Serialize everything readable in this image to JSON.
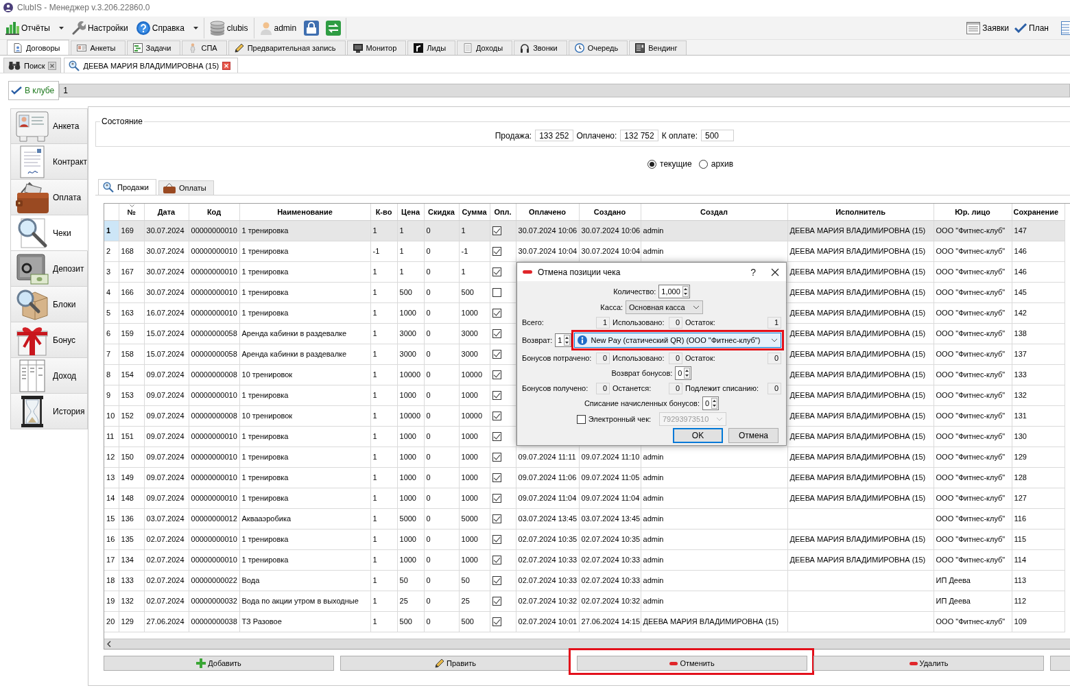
{
  "window": {
    "title": "ClubIS - Менеджер v.3.206.22860.0"
  },
  "toolbar": {
    "groups": [
      [
        {
          "label": "Отчёты",
          "dropdown": true
        },
        {
          "label": "Настройки",
          "dropdown": false
        },
        {
          "label": "Справка",
          "dropdown": true
        }
      ],
      [
        {
          "label": "clubis",
          "dropdown": false
        }
      ],
      [
        {
          "label": "admin",
          "dropdown": false
        }
      ]
    ],
    "right": [
      {
        "label": "Заявки"
      },
      {
        "label": "План"
      }
    ]
  },
  "main_tabs": [
    {
      "label": "Договоры",
      "selected": true
    },
    {
      "label": "Анкеты",
      "selected": false
    },
    {
      "label": "Задачи",
      "selected": false
    },
    {
      "label": "СПА",
      "selected": false
    },
    {
      "label": "Предварительная запись",
      "selected": false
    },
    {
      "label": "Монитор",
      "selected": false
    },
    {
      "label": "Лиды",
      "selected": false
    },
    {
      "label": "Доходы",
      "selected": false
    },
    {
      "label": "Звонки",
      "selected": false
    },
    {
      "label": "Очередь",
      "selected": false
    },
    {
      "label": "Вендинг",
      "selected": false
    }
  ],
  "document_tabs": [
    {
      "label": "Поиск",
      "selected": false
    },
    {
      "label": "ДЕЕВА МАРИЯ ВЛАДИМИРОВНА (15)",
      "selected": true
    }
  ],
  "client_status": {
    "label": "В клубе",
    "value": "1"
  },
  "sidebar": {
    "items": [
      {
        "label": "Анкета",
        "selected": false
      },
      {
        "label": "Контракт",
        "selected": false
      },
      {
        "label": "Оплата",
        "selected": false
      },
      {
        "label": "Чеки",
        "selected": true
      },
      {
        "label": "Депозит",
        "selected": false
      },
      {
        "label": "Блоки",
        "selected": false
      },
      {
        "label": "Бонус",
        "selected": false
      },
      {
        "label": "Доход",
        "selected": false
      },
      {
        "label": "История",
        "selected": false
      }
    ]
  },
  "state": {
    "title": "Состояние",
    "fields": [
      {
        "label": "Продажа:",
        "value": "133 252"
      },
      {
        "label": "Оплачено:",
        "value": "132 752"
      },
      {
        "label": "К оплате:",
        "value": "500"
      }
    ]
  },
  "filter": [
    {
      "label": "текущие",
      "selected": true
    },
    {
      "label": "архив",
      "selected": false
    }
  ],
  "sub_tabs": [
    {
      "label": "Продажи",
      "selected": true
    },
    {
      "label": "Оплаты",
      "selected": false
    }
  ],
  "table": {
    "columns": [
      "№",
      "Дата",
      "Код",
      "Наименование",
      "К-во",
      "Цена",
      "Скидка",
      "Сумма",
      "Опл.",
      "Оплачено",
      "Создано",
      "Создал",
      "Исполнитель",
      "Юр. лицо",
      "Сохранение"
    ],
    "rows": [
      {
        "n": "1",
        "selected": true,
        "no": "169",
        "date": "30.07.2024",
        "code": "00000000010",
        "name": "1 тренировка",
        "qty": "1",
        "price": "1",
        "discount": "0",
        "sum": "1",
        "paid": true,
        "paid_at": "30.07.2024 10:06",
        "created_at": "30.07.2024 10:06",
        "created_by": "admin",
        "executor": "ДЕЕВА МАРИЯ ВЛАДИМИРОВНА (15)",
        "legal_entity": "ООО \"Фитнес-клуб\"",
        "saved": "147"
      },
      {
        "n": "2",
        "selected": false,
        "no": "168",
        "date": "30.07.2024",
        "code": "00000000010",
        "name": "1 тренировка",
        "qty": "-1",
        "price": "1",
        "discount": "0",
        "sum": "-1",
        "paid": true,
        "paid_at": "30.07.2024 10:04",
        "created_at": "30.07.2024 10:04",
        "created_by": "admin",
        "executor": "ДЕЕВА МАРИЯ ВЛАДИМИРОВНА (15)",
        "legal_entity": "ООО \"Фитнес-клуб\"",
        "saved": "146"
      },
      {
        "n": "3",
        "selected": false,
        "no": "167",
        "date": "30.07.2024",
        "code": "00000000010",
        "name": "1 тренировка",
        "qty": "1",
        "price": "1",
        "discount": "0",
        "sum": "1",
        "paid": true,
        "executor": "ДЕЕВА МАРИЯ ВЛАДИМИРОВНА (15)",
        "legal_entity": "ООО \"Фитнес-клуб\"",
        "saved": "146"
      },
      {
        "n": "4",
        "selected": false,
        "no": "166",
        "date": "30.07.2024",
        "code": "00000000010",
        "name": "1 тренировка",
        "qty": "1",
        "price": "500",
        "discount": "0",
        "sum": "500",
        "paid": false,
        "executor": "ДЕЕВА МАРИЯ ВЛАДИМИРОВНА (15)",
        "legal_entity": "ООО \"Фитнес-клуб\"",
        "saved": "145"
      },
      {
        "n": "5",
        "selected": false,
        "no": "163",
        "date": "16.07.2024",
        "code": "00000000010",
        "name": "1 тренировка",
        "qty": "1",
        "price": "1000",
        "discount": "0",
        "sum": "1000",
        "paid": true,
        "executor": "ДЕЕВА МАРИЯ ВЛАДИМИРОВНА (15)",
        "legal_entity": "ООО \"Фитнес-клуб\"",
        "saved": "142"
      },
      {
        "n": "6",
        "selected": false,
        "no": "159",
        "date": "15.07.2024",
        "code": "00000000058",
        "name": "Аренда кабинки в раздевалке",
        "qty": "1",
        "price": "3000",
        "discount": "0",
        "sum": "3000",
        "paid": true,
        "executor": "ДЕЕВА МАРИЯ ВЛАДИМИРОВНА (15)",
        "legal_entity": "ООО \"Фитнес-клуб\"",
        "saved": "138"
      },
      {
        "n": "7",
        "selected": false,
        "no": "158",
        "date": "15.07.2024",
        "code": "00000000058",
        "name": "Аренда кабинки в раздевалке",
        "qty": "1",
        "price": "3000",
        "discount": "0",
        "sum": "3000",
        "paid": true,
        "executor": "ДЕЕВА МАРИЯ ВЛАДИМИРОВНА (15)",
        "legal_entity": "ООО \"Фитнес-клуб\"",
        "saved": "137"
      },
      {
        "n": "8",
        "selected": false,
        "no": "154",
        "date": "09.07.2024",
        "code": "00000000008",
        "name": "10 тренировок",
        "qty": "1",
        "price": "10000",
        "discount": "0",
        "sum": "10000",
        "paid": true,
        "executor": "ДЕЕВА МАРИЯ ВЛАДИМИРОВНА (15)",
        "legal_entity": "ООО \"Фитнес-клуб\"",
        "saved": "133"
      },
      {
        "n": "9",
        "selected": false,
        "no": "153",
        "date": "09.07.2024",
        "code": "00000000010",
        "name": "1 тренировка",
        "qty": "1",
        "price": "1000",
        "discount": "0",
        "sum": "1000",
        "paid": true,
        "executor": "ДЕЕВА МАРИЯ ВЛАДИМИРОВНА (15)",
        "legal_entity": "ООО \"Фитнес-клуб\"",
        "saved": "132"
      },
      {
        "n": "10",
        "selected": false,
        "no": "152",
        "date": "09.07.2024",
        "code": "00000000008",
        "name": "10 тренировок",
        "qty": "1",
        "price": "10000",
        "discount": "0",
        "sum": "10000",
        "paid": true,
        "executor": "ДЕЕВА МАРИЯ ВЛАДИМИРОВНА (15)",
        "legal_entity": "ООО \"Фитнес-клуб\"",
        "saved": "131"
      },
      {
        "n": "11",
        "selected": false,
        "no": "151",
        "date": "09.07.2024",
        "code": "00000000010",
        "name": "1 тренировка",
        "qty": "1",
        "price": "1000",
        "discount": "0",
        "sum": "1000",
        "paid": true,
        "executor": "ДЕЕВА МАРИЯ ВЛАДИМИРОВНА (15)",
        "legal_entity": "ООО \"Фитнес-клуб\"",
        "saved": "130"
      },
      {
        "n": "12",
        "selected": false,
        "no": "150",
        "date": "09.07.2024",
        "code": "00000000010",
        "name": "1 тренировка",
        "qty": "1",
        "price": "1000",
        "discount": "0",
        "sum": "1000",
        "paid": true,
        "paid_at": "09.07.2024 11:11",
        "created_at": "09.07.2024 11:10",
        "created_by": "admin",
        "executor": "ДЕЕВА МАРИЯ ВЛАДИМИРОВНА (15)",
        "legal_entity": "ООО \"Фитнес-клуб\"",
        "saved": "129"
      },
      {
        "n": "13",
        "selected": false,
        "no": "149",
        "date": "09.07.2024",
        "code": "00000000010",
        "name": "1 тренировка",
        "qty": "1",
        "price": "1000",
        "discount": "0",
        "sum": "1000",
        "paid": true,
        "paid_at": "09.07.2024 11:06",
        "created_at": "09.07.2024 11:05",
        "created_by": "admin",
        "executor": "ДЕЕВА МАРИЯ ВЛАДИМИРОВНА (15)",
        "legal_entity": "ООО \"Фитнес-клуб\"",
        "saved": "128"
      },
      {
        "n": "14",
        "selected": false,
        "no": "148",
        "date": "09.07.2024",
        "code": "00000000010",
        "name": "1 тренировка",
        "qty": "1",
        "price": "1000",
        "discount": "0",
        "sum": "1000",
        "paid": true,
        "paid_at": "09.07.2024 11:04",
        "created_at": "09.07.2024 11:04",
        "created_by": "admin",
        "executor": "ДЕЕВА МАРИЯ ВЛАДИМИРОВНА (15)",
        "legal_entity": "ООО \"Фитнес-клуб\"",
        "saved": "127"
      },
      {
        "n": "15",
        "selected": false,
        "no": "136",
        "date": "03.07.2024",
        "code": "00000000012",
        "name": "Аквааэробика",
        "qty": "1",
        "price": "5000",
        "discount": "0",
        "sum": "5000",
        "paid": true,
        "paid_at": "03.07.2024 13:45",
        "created_at": "03.07.2024 13:45",
        "created_by": "admin",
        "legal_entity": "ООО \"Фитнес-клуб\"",
        "saved": "116"
      },
      {
        "n": "16",
        "selected": false,
        "no": "135",
        "date": "02.07.2024",
        "code": "00000000010",
        "name": "1 тренировка",
        "qty": "1",
        "price": "1000",
        "discount": "0",
        "sum": "1000",
        "paid": true,
        "paid_at": "02.07.2024 10:35",
        "created_at": "02.07.2024 10:35",
        "created_by": "admin",
        "executor": "ДЕЕВА МАРИЯ ВЛАДИМИРОВНА (15)",
        "legal_entity": "ООО \"Фитнес-клуб\"",
        "saved": "115"
      },
      {
        "n": "17",
        "selected": false,
        "no": "134",
        "date": "02.07.2024",
        "code": "00000000010",
        "name": "1 тренировка",
        "qty": "1",
        "price": "1000",
        "discount": "0",
        "sum": "1000",
        "paid": true,
        "paid_at": "02.07.2024 10:33",
        "created_at": "02.07.2024 10:33",
        "created_by": "admin",
        "executor": "ДЕЕВА МАРИЯ ВЛАДИМИРОВНА (15)",
        "legal_entity": "ООО \"Фитнес-клуб\"",
        "saved": "114"
      },
      {
        "n": "18",
        "selected": false,
        "no": "133",
        "date": "02.07.2024",
        "code": "00000000022",
        "name": "Вода",
        "qty": "1",
        "price": "50",
        "discount": "0",
        "sum": "50",
        "paid": true,
        "paid_at": "02.07.2024 10:33",
        "created_at": "02.07.2024 10:33",
        "created_by": "admin",
        "legal_entity": "ИП Деева",
        "saved": "113"
      },
      {
        "n": "19",
        "selected": false,
        "no": "132",
        "date": "02.07.2024",
        "code": "00000000032",
        "name": "Вода по акции утром в выходные",
        "qty": "1",
        "price": "25",
        "discount": "0",
        "sum": "25",
        "paid": true,
        "paid_at": "02.07.2024 10:32",
        "created_at": "02.07.2024 10:32",
        "created_by": "admin",
        "legal_entity": "ИП Деева",
        "saved": "112"
      },
      {
        "n": "20",
        "selected": false,
        "no": "129",
        "date": "27.06.2024",
        "code": "00000000038",
        "name": "ТЗ Разовое",
        "qty": "1",
        "price": "500",
        "discount": "0",
        "sum": "500",
        "paid": true,
        "paid_at": "02.07.2024 10:01",
        "created_at": "27.06.2024 14:15",
        "created_by": "ДЕЕВА МАРИЯ ВЛАДИМИРОВНА (15)",
        "legal_entity": "ООО \"Фитнес-клуб\"",
        "saved": "109"
      }
    ]
  },
  "actions": [
    {
      "label": "Добавить",
      "highlighted": false
    },
    {
      "label": "Править",
      "highlighted": false
    },
    {
      "label": "Отменить",
      "highlighted": true
    },
    {
      "label": "Удалить",
      "highlighted": false
    }
  ],
  "dialog": {
    "title": "Отмена позиции чека",
    "help": "?",
    "rows": [
      {
        "kind": "spin",
        "label": "Количество:",
        "value": "1,000"
      },
      {
        "kind": "combo",
        "label": "Касса:",
        "value": "Основная касса"
      },
      {
        "kind": "triple",
        "items": [
          {
            "label": "Всего:",
            "value": "1"
          },
          {
            "label": "Использовано:",
            "value": "0"
          },
          {
            "label": "Остаток:",
            "value": "1"
          }
        ]
      },
      {
        "kind": "refund",
        "label": "Возврат:",
        "value": "1",
        "method": "New Pay (статический QR) (ООО \"Фитнес-клуб\")",
        "highlighted": true
      },
      {
        "kind": "triple",
        "items": [
          {
            "label": "Бонусов потрачено:",
            "value": "0"
          },
          {
            "label": "Использовано:",
            "value": "0"
          },
          {
            "label": "Остаток:",
            "value": "0"
          }
        ]
      },
      {
        "kind": "spin",
        "label": "Возврат бонусов:",
        "value": "0"
      },
      {
        "kind": "triple",
        "items": [
          {
            "label": "Бонусов получено:",
            "value": "0"
          },
          {
            "label": "Останется:",
            "value": "0"
          },
          {
            "label": "Подлежит списанию:",
            "value": "0"
          }
        ]
      },
      {
        "kind": "spin",
        "label": "Списание начисленных бонусов:",
        "value": "0"
      },
      {
        "kind": "check",
        "label": "Электронный чек:",
        "checked": false,
        "value": "79293973510",
        "disabled": true
      }
    ],
    "buttons": [
      {
        "label": "OK",
        "default": true
      },
      {
        "label": "Отмена",
        "default": false
      }
    ]
  }
}
